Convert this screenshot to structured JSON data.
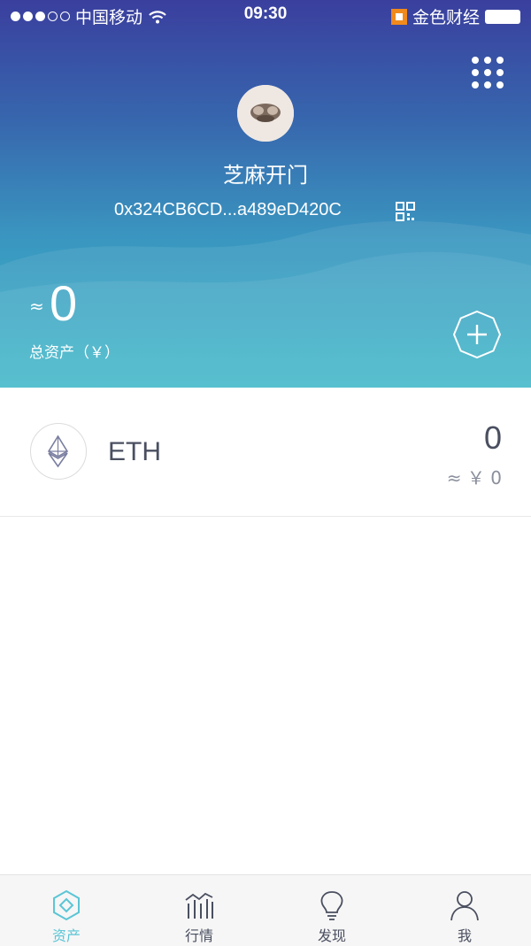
{
  "status_bar": {
    "carrier": "中国移动",
    "time": "09:30",
    "brand": "金色财经"
  },
  "wallet": {
    "name": "芝麻开门",
    "address": "0x324CB6CD...a489eD420C",
    "approx_symbol": "≈",
    "total_value": "0",
    "total_label": "总资产（￥）"
  },
  "assets": [
    {
      "symbol": "ETH",
      "amount": "0",
      "value": "≈ ￥ 0",
      "icon": "ethereum-icon"
    }
  ],
  "tabs": [
    {
      "label": "资产",
      "icon": "wallet-diamond-icon",
      "active": true
    },
    {
      "label": "行情",
      "icon": "chart-bars-icon",
      "active": false
    },
    {
      "label": "发现",
      "icon": "lightbulb-icon",
      "active": false
    },
    {
      "label": "我",
      "icon": "person-icon",
      "active": false
    }
  ],
  "colors": {
    "header_top": "#3a3f9e",
    "header_bottom": "#3cb7c8",
    "accent": "#5ac6d6",
    "text": "#4a4f60"
  }
}
